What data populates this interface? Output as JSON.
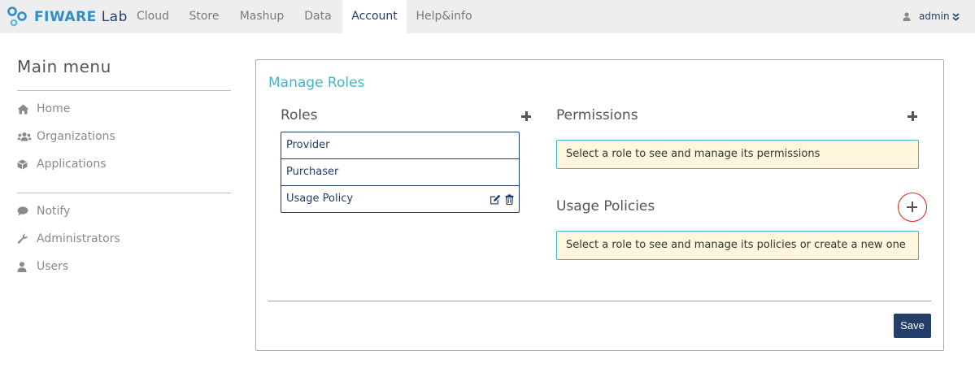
{
  "brand": {
    "name_part1": "FIWARE",
    "name_part2": "Lab",
    "icon": "fiware-logo-icon"
  },
  "nav": {
    "items": [
      {
        "label": "Cloud"
      },
      {
        "label": "Store"
      },
      {
        "label": "Mashup"
      },
      {
        "label": "Data"
      },
      {
        "label": "Account",
        "active": true
      },
      {
        "label": "Help&info"
      }
    ],
    "user": {
      "label": "admin",
      "icon": "user-icon",
      "chevron_icon": "chevron-down-double-icon"
    }
  },
  "sidebar": {
    "title": "Main menu",
    "items": [
      {
        "label": "Home",
        "icon": "home-icon"
      },
      {
        "label": "Organizations",
        "icon": "users-icon"
      },
      {
        "label": "Applications",
        "icon": "cube-icon"
      },
      {
        "label": "Notify",
        "icon": "comment-icon"
      },
      {
        "label": "Administrators",
        "icon": "wrench-icon"
      },
      {
        "label": "Users",
        "icon": "user-icon"
      }
    ]
  },
  "main": {
    "title": "Manage Roles",
    "roles": {
      "heading": "Roles",
      "add_icon": "plus-icon",
      "items": [
        {
          "label": "Provider"
        },
        {
          "label": "Purchaser"
        },
        {
          "label": "Usage Policy",
          "actions": [
            "edit-icon",
            "trash-icon"
          ]
        }
      ]
    },
    "permissions": {
      "heading": "Permissions",
      "add_icon": "plus-icon",
      "message": "Select a role to see and manage its permissions"
    },
    "usage_policies": {
      "heading": "Usage Policies",
      "add_icon": "plus-icon",
      "message": "Select a role to see and manage its policies or create a new one"
    },
    "save_label": "Save"
  },
  "colors": {
    "accent": "#46b4c8",
    "primary": "#233e6b",
    "info_bg": "#fff6dc",
    "highlight_ring": "#e02020",
    "nav_bg": "#eeeeee"
  }
}
